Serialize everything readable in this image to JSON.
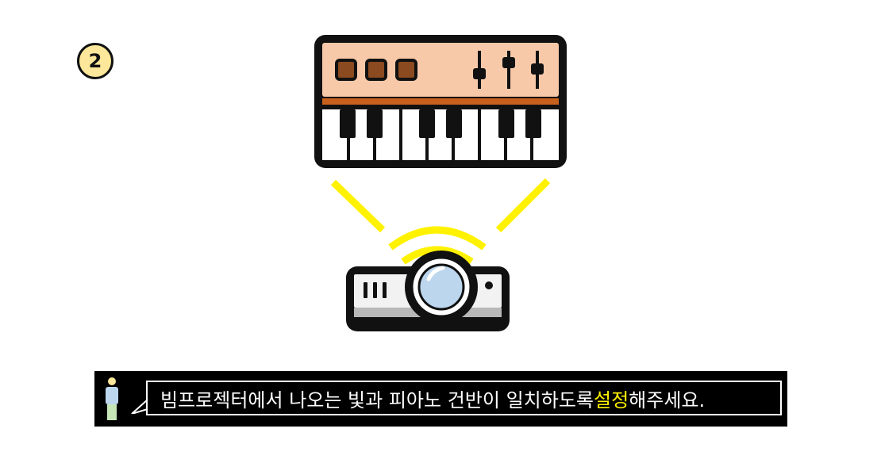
{
  "step": {
    "number": "2"
  },
  "caption": {
    "text_before": "빔프로젝터에서 나오는 빛과 피아노 건반이 일치하도록 ",
    "text_highlight": "설정",
    "text_after": "해주세요."
  },
  "colors": {
    "badge_fill": "#fde79a",
    "keyboard_panel": "#f8c9a9",
    "keyboard_buttons": "#8b4a1f",
    "keyboard_stripe": "#c8611d",
    "light_beam": "#fff200",
    "lens": "#bcd6ee",
    "caption_highlight": "#fff200"
  },
  "icons": [
    "synthesizer-keyboard-icon",
    "projector-icon",
    "person-icon"
  ]
}
